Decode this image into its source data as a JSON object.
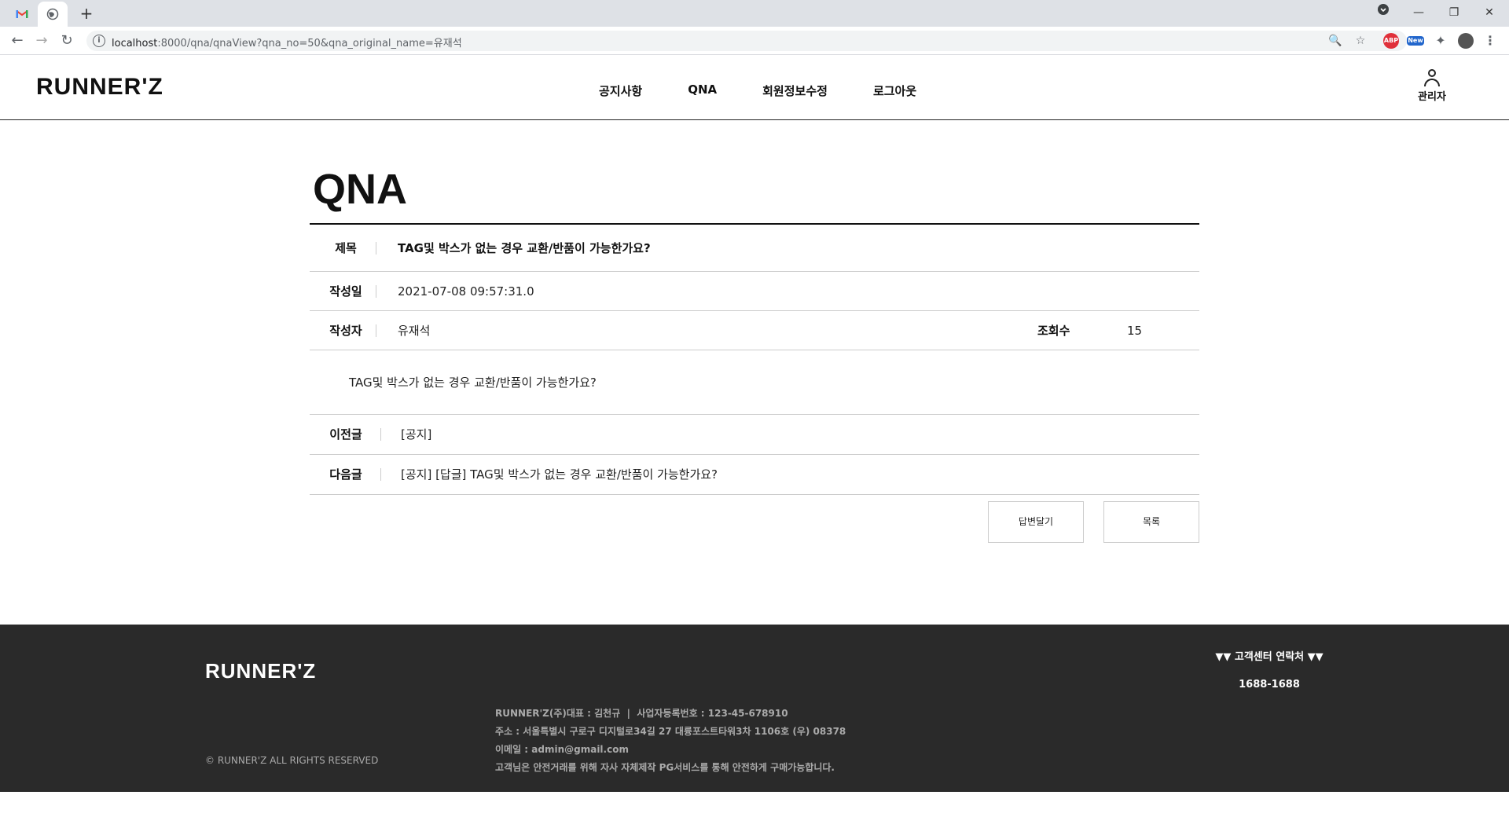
{
  "browser": {
    "url_host": "localhost",
    "url_rest": ":8000/qna/qnaView?qna_no=50&qna_original_name=유재석",
    "new_tab": "+",
    "ext_abp": "ABP",
    "ext_new": "New"
  },
  "header": {
    "logo": "RUNNER'Z",
    "nav": [
      "공지사항",
      "QNA",
      "회원정보수정",
      "로그아웃"
    ],
    "user_label": "관리자"
  },
  "page": {
    "title": "QNA"
  },
  "post": {
    "title_label": "제목",
    "title": "TAG및 박스가 없는 경우 교환/반품이 가능한가요?",
    "date_label": "작성일",
    "date": "2021-07-08 09:57:31.0",
    "author_label": "작성자",
    "author": "유재석",
    "views_label": "조회수",
    "views": "15",
    "body": "TAG및 박스가 없는 경우 교환/반품이 가능한가요?",
    "prev_label": "이전글",
    "prev": "[공지]",
    "next_label": "다음글",
    "next": "[공지] [답글] TAG및 박스가 없는 경우 교환/반품이 가능한가요?"
  },
  "buttons": {
    "reply": "답변달기",
    "list": "목록"
  },
  "footer": {
    "logo": "RUNNER'Z",
    "copyright": "© RUNNER'Z ALL RIGHTS RESERVED",
    "info_line1": "RUNNER'Z(주)대표 : 김천규  |  사업자등록번호 : 123-45-678910",
    "info_line2": "주소 : 서울특별시 구로구 디지털로34길 27 대륭포스트타워3차 1106호 (우) 08378",
    "info_line3": "이메일 : admin@gmail.com",
    "info_line4": "고객님은 안전거래를 위해 자사 자체제작 PG서비스를 통해 안전하게 구매가능합니다.",
    "cs_title": "▼▼ 고객센터 연락처 ▼▼",
    "cs_tel": "1688-1688"
  }
}
